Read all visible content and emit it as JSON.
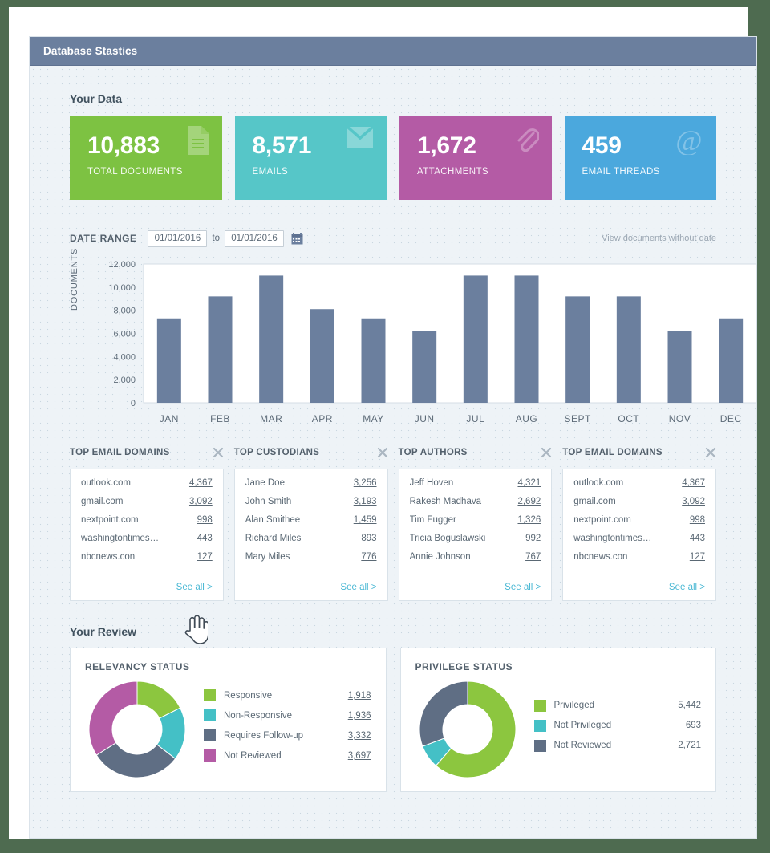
{
  "window": {
    "title": "Database Stastics"
  },
  "sections": {
    "your_data": "Your Data",
    "your_review": "Your Review"
  },
  "colors": {
    "green": "#7dc242",
    "teal": "#56c6c8",
    "purple": "#b45ba5",
    "blue": "#4ba8dd",
    "slate": "#6b7f9e",
    "link": "#4ab8d4",
    "header_bar": "#6b7f9e"
  },
  "stat_cards": [
    {
      "value": "10,883",
      "label": "TOTAL DOCUMENTS",
      "color": "#7dc242",
      "icon": "document-icon"
    },
    {
      "value": "8,571",
      "label": "EMAILS",
      "color": "#56c6c8",
      "icon": "envelope-icon"
    },
    {
      "value": "1,672",
      "label": "ATTACHMENTS",
      "color": "#b45ba5",
      "icon": "paperclip-icon"
    },
    {
      "value": "459",
      "label": "EMAIL THREADS",
      "color": "#4ba8dd",
      "icon": "at-sign-icon"
    }
  ],
  "date_range": {
    "label": "DATE RANGE",
    "start_value": "01/01/2016",
    "end_value": "01/01/2016",
    "separator": "to",
    "calendar_icon": "calendar-icon",
    "view_without_date": "View documents without date"
  },
  "chart_data": {
    "type": "bar",
    "title": "",
    "xlabel": "",
    "ylabel": "DOCUMENTS",
    "categories": [
      "JAN",
      "FEB",
      "MAR",
      "APR",
      "MAY",
      "JUN",
      "JUL",
      "AUG",
      "SEPT",
      "OCT",
      "NOV",
      "DEC"
    ],
    "values": [
      7300,
      9200,
      11000,
      8100,
      7300,
      6200,
      11000,
      11000,
      9200,
      9200,
      6200,
      7300
    ],
    "ylim": [
      0,
      12000
    ],
    "yticks": [
      0,
      2000,
      4000,
      6000,
      8000,
      10000,
      12000
    ],
    "ytick_labels": [
      "0",
      "2,000",
      "4,000",
      "6,000",
      "8,000",
      "10,000",
      "12,000"
    ],
    "grid": false,
    "legend": "none",
    "bar_color": "#6b7f9e"
  },
  "lists": [
    {
      "title": "TOP EMAIL DOMAINS",
      "close_icon": "close-icon",
      "see_all": "See all >",
      "rows": [
        {
          "name": "outlook.com",
          "value": "4,367"
        },
        {
          "name": "gmail.com",
          "value": "3,092"
        },
        {
          "name": "nextpoint.com",
          "value": "998"
        },
        {
          "name": "washingtontimes…",
          "value": "443"
        },
        {
          "name": "nbcnews.con",
          "value": "127"
        }
      ]
    },
    {
      "title": "TOP CUSTODIANS",
      "close_icon": "close-icon",
      "see_all": "See all >",
      "rows": [
        {
          "name": "Jane Doe",
          "value": "3,256"
        },
        {
          "name": "John Smith",
          "value": "3,193"
        },
        {
          "name": "Alan Smithee",
          "value": "1,459"
        },
        {
          "name": "Richard Miles",
          "value": "893"
        },
        {
          "name": "Mary Miles",
          "value": "776"
        }
      ]
    },
    {
      "title": "TOP AUTHORS",
      "close_icon": "close-icon",
      "see_all": "See all >",
      "rows": [
        {
          "name": "Jeff Hoven",
          "value": "4,321"
        },
        {
          "name": "Rakesh Madhava",
          "value": "2,692"
        },
        {
          "name": "Tim Fugger",
          "value": "1,326"
        },
        {
          "name": "Tricia Boguslawski",
          "value": "992"
        },
        {
          "name": "Annie Johnson",
          "value": "767"
        }
      ]
    },
    {
      "title": "TOP EMAIL DOMAINS",
      "close_icon": "close-icon",
      "see_all": "See all >",
      "rows": [
        {
          "name": "outlook.com",
          "value": "4,367"
        },
        {
          "name": "gmail.com",
          "value": "3,092"
        },
        {
          "name": "nextpoint.com",
          "value": "998"
        },
        {
          "name": "washingtontimes…",
          "value": "443"
        },
        {
          "name": "nbcnews.con",
          "value": "127"
        }
      ]
    }
  ],
  "donuts": [
    {
      "title": "RELEVANCY STATUS",
      "type": "pie",
      "labels": [
        "Responsive",
        "Non-Responsive",
        "Requires Follow-up",
        "Not Reviewed"
      ],
      "values": [
        1918,
        1936,
        3332,
        3697
      ],
      "value_labels": [
        "1,918",
        "1,936",
        "3,332",
        "3,697"
      ],
      "colors": [
        "#8cc63f",
        "#44c0c6",
        "#5f6e84",
        "#b45ba5"
      ]
    },
    {
      "title": "PRIVILEGE STATUS",
      "type": "pie",
      "labels": [
        "Privileged",
        "Not Privileged",
        "Not Reviewed"
      ],
      "values": [
        5442,
        693,
        2721
      ],
      "value_labels": [
        "5,442",
        "693",
        "2,721"
      ],
      "colors": [
        "#8cc63f",
        "#44c0c6",
        "#5f6e84"
      ]
    }
  ]
}
